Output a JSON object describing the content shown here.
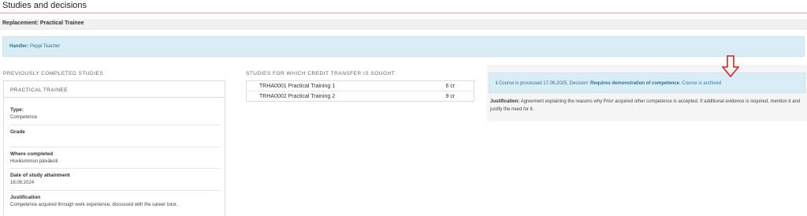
{
  "page_title": "Studies and decisions",
  "replacement": "Replacement: Practical Trainee",
  "handler": {
    "label": "Handler:",
    "name": "Peppi Teacher"
  },
  "previous": {
    "heading": "PREVIOUSLY COMPLETED STUDIES",
    "card_title": "PRACTICAL TRAINEE",
    "type_label": "Type:",
    "type_value": "Competence",
    "grade_label": "Grade",
    "grade_value": "",
    "where_label": "Where completed",
    "where_value": "Huvikummun päiväkoti",
    "date_label": "Date of study attainment",
    "date_value": "18.08.2024",
    "justification_label": "Justification",
    "justification_value": "Competence acquired through work experience, discussed with the career tutor."
  },
  "credit": {
    "heading": "STUDIES FOR WHICH CREDIT TRANSFER IS SOUGHT",
    "rows": [
      {
        "name": "TRHA0001 Practical Training 1",
        "credits": "6 cr"
      },
      {
        "name": "TRHA0002 Practical Training 2",
        "credits": "9 cr"
      }
    ]
  },
  "decision": {
    "info_icon": "info-icon",
    "processed_text": "Course is processed 17.06.2025, Decision:",
    "decision_value": "Requires demonstration of competence",
    "archived_text": "Course is archived",
    "justification_label": "Justification:",
    "justification_text": "Agreement explaining the reasons why Prior acquired other competence is accepted. If additional evidence is required, mention it and justify the need for it."
  },
  "colors": {
    "header_rule": "#e8a0a4",
    "info_bg": "#d9edf7",
    "info_text": "#31708f",
    "annotation_arrow": "#e02020"
  }
}
